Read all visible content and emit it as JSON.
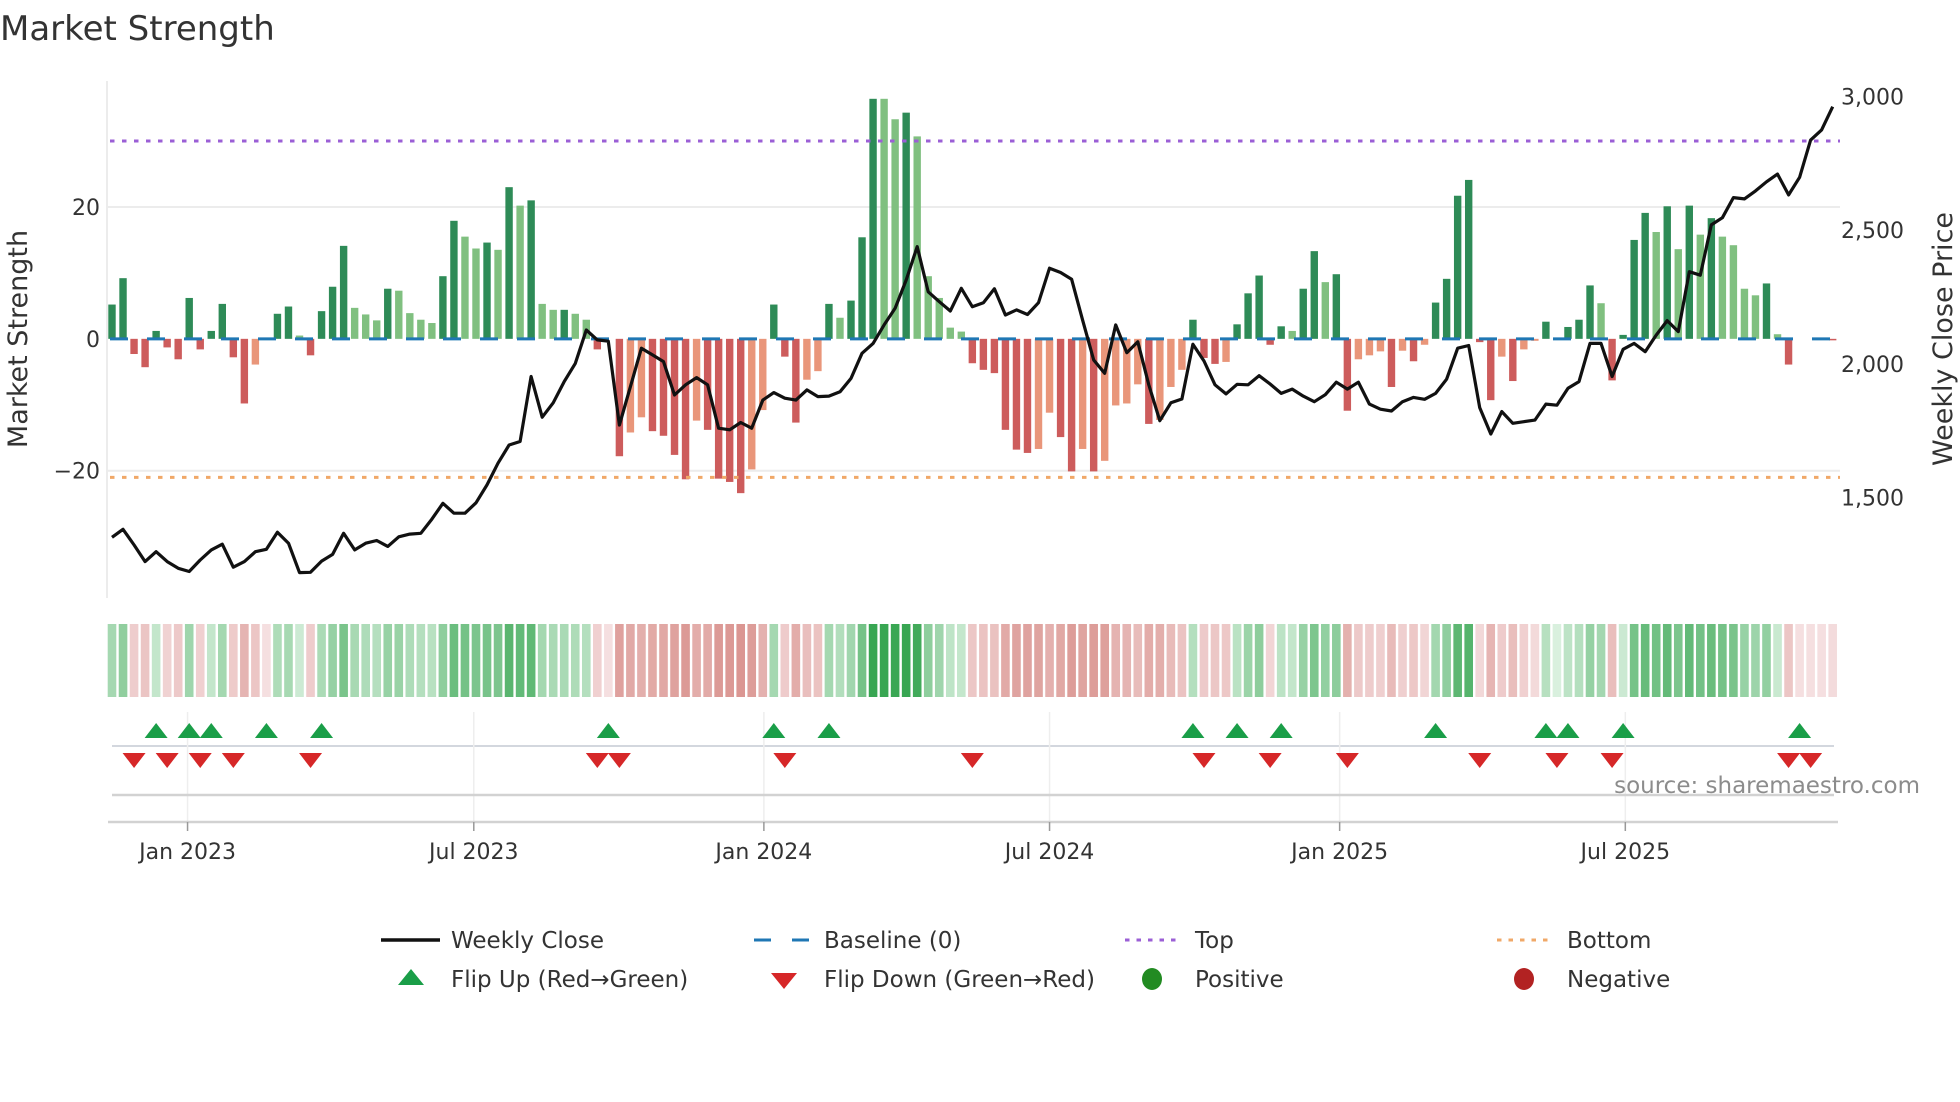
{
  "chart_data": {
    "type": "bar",
    "title": "Market Strength",
    "ylabel": "Market Strength",
    "y2label": "Weekly Close Price",
    "source": "source: sharemaestro.com",
    "ylim": [
      -39.3,
      39.1
    ],
    "y2lim": [
      1125,
      3058
    ],
    "yticks": [
      {
        "value": 20,
        "label": "20"
      },
      {
        "value": 0,
        "label": "0"
      },
      {
        "value": -20,
        "label": "−20"
      }
    ],
    "y2ticks": [
      {
        "value": 3000,
        "label": "3,000"
      },
      {
        "value": 2500,
        "label": "2,500"
      },
      {
        "value": 2000,
        "label": "2,000"
      },
      {
        "value": 1500,
        "label": "1,500"
      }
    ],
    "xticks": [
      {
        "week": 6.85,
        "label": "Jan 2023"
      },
      {
        "week": 32.8,
        "label": "Jul 2023"
      },
      {
        "week": 59.1,
        "label": "Jan 2024"
      },
      {
        "week": 85.0,
        "label": "Jul 2024"
      },
      {
        "week": 111.3,
        "label": "Jan 2025"
      },
      {
        "week": 137.2,
        "label": "Jul 2025"
      }
    ],
    "top_level": 30,
    "bottom_level": -21,
    "baseline": 0,
    "colors": {
      "DG": "#2e8b57",
      "LG": "#80c080",
      "DR": "#cd5c5c",
      "LR": "#e9967a",
      "price": "#111111",
      "baseline": "#1f77b4",
      "top": "#9b5fd6",
      "bottom": "#f0a868",
      "flip_up": "#1a9e48",
      "flip_down": "#d62728",
      "positive": "#228b22",
      "negative": "#b22222"
    },
    "strength": [
      5.2,
      9.2,
      -2.3,
      -4.3,
      1.2,
      -1.3,
      -3.1,
      6.2,
      -1.6,
      1.2,
      5.3,
      -2.8,
      -9.8,
      -3.9,
      0,
      3.8,
      4.9,
      0.5,
      -2.5,
      4.2,
      7.9,
      14.1,
      4.7,
      3.7,
      2.8,
      7.6,
      7.3,
      3.9,
      2.9,
      2.4,
      9.5,
      17.9,
      15.5,
      13.7,
      14.6,
      13.5,
      23.0,
      20.2,
      21.0,
      5.3,
      4.4,
      4.4,
      3.8,
      2.9,
      -1.6,
      0,
      -17.8,
      -14.2,
      -11.9,
      -14.0,
      -14.7,
      -17.6,
      -21.3,
      -12.4,
      -13.8,
      -21.2,
      -21.7,
      -23.4,
      -19.8,
      -10.8,
      5.2,
      -2.7,
      -12.7,
      -6.2,
      -4.9,
      5.3,
      3.2,
      5.8,
      15.4,
      36.4,
      36.4,
      33.3,
      34.3,
      30.7,
      9.5,
      6.2,
      1.7,
      1.1,
      -3.7,
      -4.7,
      -5.2,
      -13.8,
      -16.8,
      -17.3,
      -16.7,
      -11.2,
      -14.9,
      -20.1,
      -16.7,
      -20.1,
      -18.5,
      -10.1,
      -9.8,
      -6.9,
      -12.9,
      -12.3,
      -7.3,
      -4.7,
      2.9,
      -2.9,
      -3.8,
      -3.5,
      2.2,
      6.9,
      9.6,
      -0.9,
      1.9,
      1.2,
      7.6,
      13.3,
      8.6,
      9.8,
      -10.9,
      -3.1,
      -2.5,
      -1.9,
      -7.3,
      -1.8,
      -3.4,
      -0.9,
      5.5,
      9.1,
      21.7,
      24.1,
      -0.5,
      -9.3,
      -2.7,
      -6.4,
      -1.6,
      -0.3,
      2.6,
      0,
      1.8,
      2.9,
      8.1,
      5.4,
      -6.3,
      0.6,
      15.0,
      19.1,
      16.2,
      20.1,
      13.6,
      20.2,
      15.8,
      18.3,
      15.5,
      14.2,
      7.6,
      6.6,
      8.4,
      0.7,
      -3.9,
      0,
      0,
      0,
      -0.2
    ],
    "bar_class": [
      "DG",
      "DG",
      "DR",
      "DR",
      "DG",
      "DR",
      "DR",
      "DG",
      "DR",
      "DG",
      "DG",
      "DR",
      "DR",
      "LR",
      "DG",
      "DG",
      "DG",
      "LG",
      "DR",
      "DG",
      "DG",
      "DG",
      "LG",
      "LG",
      "LG",
      "DG",
      "LG",
      "LG",
      "LG",
      "LG",
      "DG",
      "DG",
      "LG",
      "LG",
      "DG",
      "LG",
      "DG",
      "LG",
      "DG",
      "LG",
      "LG",
      "DG",
      "LG",
      "LG",
      "DR",
      "DR",
      "DR",
      "LR",
      "LR",
      "DR",
      "DR",
      "DR",
      "DR",
      "LR",
      "DR",
      "DR",
      "DR",
      "DR",
      "LR",
      "LR",
      "DG",
      "DR",
      "DR",
      "LR",
      "LR",
      "DG",
      "LG",
      "DG",
      "DG",
      "DG",
      "LG",
      "LG",
      "DG",
      "LG",
      "LG",
      "LG",
      "LG",
      "LG",
      "DR",
      "DR",
      "DR",
      "DR",
      "DR",
      "DR",
      "LR",
      "LR",
      "DR",
      "DR",
      "LR",
      "DR",
      "LR",
      "LR",
      "LR",
      "LR",
      "DR",
      "LR",
      "LR",
      "LR",
      "DG",
      "DR",
      "DR",
      "LR",
      "DG",
      "DG",
      "DG",
      "DR",
      "DG",
      "LG",
      "DG",
      "DG",
      "LG",
      "DG",
      "DR",
      "LR",
      "LR",
      "LR",
      "DR",
      "LR",
      "DR",
      "LR",
      "DG",
      "DG",
      "DG",
      "DG",
      "DR",
      "DR",
      "LR",
      "DR",
      "LR",
      "LR",
      "DG",
      "DG",
      "DG",
      "DG",
      "DG",
      "LG",
      "DR",
      "DG",
      "DG",
      "DG",
      "LG",
      "DG",
      "LG",
      "DG",
      "LG",
      "DG",
      "LG",
      "LG",
      "LG",
      "LG",
      "DG",
      "LG",
      "DR",
      "DR",
      "DR",
      "DR",
      "DR"
    ],
    "weekly_close": [
      1352,
      1382,
      1323,
      1261,
      1298,
      1261,
      1236,
      1224,
      1267,
      1305,
      1326,
      1240,
      1261,
      1298,
      1307,
      1371,
      1330,
      1220,
      1221,
      1263,
      1288,
      1367,
      1305,
      1330,
      1340,
      1318,
      1354,
      1364,
      1367,
      1420,
      1479,
      1442,
      1442,
      1481,
      1548,
      1629,
      1697,
      1710,
      1953,
      1801,
      1855,
      1934,
      2002,
      2127,
      2090,
      2085,
      1772,
      1915,
      2059,
      2034,
      2009,
      1884,
      1922,
      1949,
      1922,
      1760,
      1754,
      1781,
      1760,
      1865,
      1893,
      1872,
      1865,
      1903,
      1878,
      1880,
      1896,
      1946,
      2040,
      2077,
      2146,
      2208,
      2314,
      2439,
      2270,
      2233,
      2198,
      2283,
      2214,
      2229,
      2281,
      2183,
      2202,
      2185,
      2229,
      2358,
      2342,
      2317,
      2164,
      2015,
      1965,
      2146,
      2042,
      2083,
      1922,
      1788,
      1855,
      1869,
      2074,
      2011,
      1922,
      1888,
      1924,
      1922,
      1956,
      1925,
      1890,
      1906,
      1880,
      1859,
      1885,
      1932,
      1906,
      1932,
      1850,
      1831,
      1824,
      1859,
      1875,
      1868,
      1890,
      1943,
      2059,
      2069,
      1837,
      1738,
      1822,
      1778,
      1784,
      1790,
      1850,
      1846,
      1909,
      1934,
      2077,
      2077,
      1953,
      2055,
      2077,
      2046,
      2108,
      2162,
      2121,
      2345,
      2332,
      2520,
      2547,
      2622,
      2617,
      2647,
      2681,
      2710,
      2632,
      2698,
      2837,
      2875,
      2962
    ],
    "flip_up_weeks": [
      5,
      8,
      10,
      15,
      20,
      46,
      61,
      66,
      99,
      103,
      107,
      121,
      131,
      133,
      138,
      154
    ],
    "flip_down_weeks": [
      3,
      6,
      9,
      12,
      19,
      45,
      47,
      62,
      79,
      100,
      106,
      113,
      125,
      132,
      137,
      153,
      155
    ],
    "legend": {
      "placement": "bottom-center",
      "items": [
        {
          "key": "weekly_close",
          "label": "Weekly Close",
          "marker": "line"
        },
        {
          "key": "baseline",
          "label": "Baseline (0)",
          "marker": "dash"
        },
        {
          "key": "top",
          "label": "Top",
          "marker": "dot"
        },
        {
          "key": "bottom",
          "label": "Bottom",
          "marker": "dot"
        },
        {
          "key": "flip_up",
          "label": "Flip Up (Red→Green)",
          "marker": "triangle-up"
        },
        {
          "key": "flip_down",
          "label": "Flip Down (Green→Red)",
          "marker": "triangle-down"
        },
        {
          "key": "positive",
          "label": "Positive",
          "marker": "circle"
        },
        {
          "key": "negative",
          "label": "Negative",
          "marker": "circle"
        }
      ]
    }
  }
}
